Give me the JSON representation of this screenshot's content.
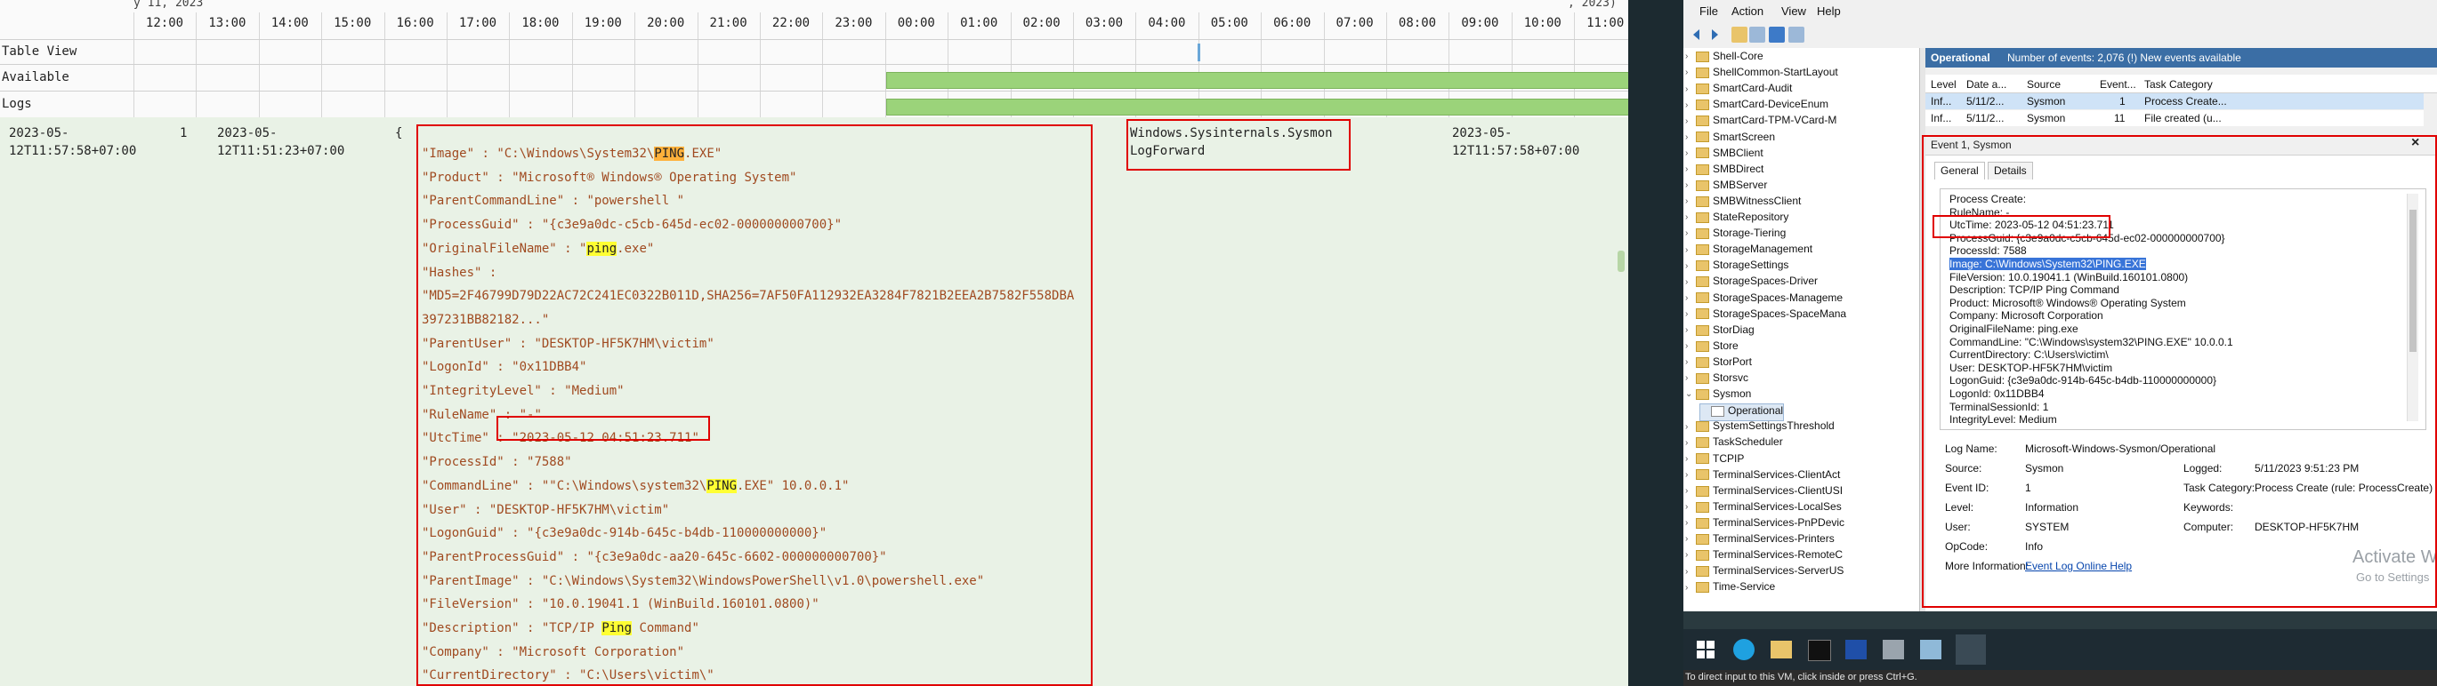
{
  "viewer": {
    "date_fragment": "y 11, 2023",
    "date_fragment_right": ", 2023)",
    "hours": [
      "12:00",
      "13:00",
      "14:00",
      "15:00",
      "16:00",
      "17:00",
      "18:00",
      "19:00",
      "20:00",
      "21:00",
      "22:00",
      "23:00",
      "00:00",
      "01:00",
      "02:00",
      "03:00",
      "04:00",
      "05:00",
      "06:00",
      "07:00",
      "08:00",
      "09:00",
      "10:00",
      "11:00"
    ],
    "row_labels": {
      "table_view": "Table View",
      "available": "Available",
      "logs": "Logs"
    },
    "row": {
      "col1": "2023-05-\n12T11:57:58+07:00",
      "col2": "1",
      "col3": "2023-05-\n12T11:51:23+07:00",
      "marker": "{",
      "source": "Windows.Sysinternals.Sysmon\nLogForward",
      "col_end": "2023-05-\n12T11:57:58+07:00"
    },
    "record": [
      {
        "k": "\"Image\"",
        "v_pre": "\"C:\\Windows\\System32\\",
        "hl": "PING",
        "hl_type": "orange",
        "v_post": ".EXE\""
      },
      {
        "k": "\"Product\"",
        "v_pre": "\"Microsoft® Windows® Operating System\"",
        "hl": "",
        "hl_type": "",
        "v_post": ""
      },
      {
        "k": "\"ParentCommandLine\"",
        "v_pre": "\"powershell \"",
        "hl": "",
        "hl_type": "",
        "v_post": ""
      },
      {
        "k": "\"ProcessGuid\"",
        "v_pre": "\"{c3e9a0dc-c5cb-645d-ec02-000000000700}\"",
        "hl": "",
        "hl_type": "",
        "v_post": ""
      },
      {
        "k": "\"OriginalFileName\"",
        "v_pre": "\"",
        "hl": "ping",
        "hl_type": "yellow",
        "v_post": ".exe\""
      },
      {
        "k": "\"Hashes\"",
        "v_pre": "",
        "hl": "",
        "hl_type": "",
        "v_post": ""
      },
      {
        "k": "",
        "v_pre": "\"MD5=2F46799D79D22AC72C241EC0322B011D,SHA256=7AF50FA112932EA3284F7821B2EEA2B7582F558DBA",
        "hl": "",
        "hl_type": "",
        "v_post": ""
      },
      {
        "k": "",
        "v_pre": "397231BB82182...\"",
        "hl": "",
        "hl_type": "",
        "v_post": ""
      },
      {
        "k": "\"ParentUser\"",
        "v_pre": "\"DESKTOP-HF5K7HM\\victim\"",
        "hl": "",
        "hl_type": "",
        "v_post": ""
      },
      {
        "k": "\"LogonId\"",
        "v_pre": "\"0x11DBB4\"",
        "hl": "",
        "hl_type": "",
        "v_post": ""
      },
      {
        "k": "\"IntegrityLevel\"",
        "v_pre": "\"Medium\"",
        "hl": "",
        "hl_type": "",
        "v_post": ""
      },
      {
        "k": "\"RuleName\"",
        "v_pre": "\"-\"",
        "hl": "",
        "hl_type": "",
        "v_post": ""
      },
      {
        "k": "\"UtcTime\"",
        "v_pre": "\"2023-05-12 04:51:23.711\"",
        "hl": "",
        "hl_type": "",
        "v_post": ""
      },
      {
        "k": "\"ProcessId\"",
        "v_pre": "\"7588\"",
        "hl": "",
        "hl_type": "",
        "v_post": ""
      },
      {
        "k": "\"CommandLine\"",
        "v_pre": "\"\"C:\\Windows\\system32\\",
        "hl": "PING",
        "hl_type": "yellow",
        "v_post": ".EXE\" 10.0.0.1\""
      },
      {
        "k": "\"User\"",
        "v_pre": "\"DESKTOP-HF5K7HM\\victim\"",
        "hl": "",
        "hl_type": "",
        "v_post": ""
      },
      {
        "k": "\"LogonGuid\"",
        "v_pre": "\"{c3e9a0dc-914b-645c-b4db-110000000000}\"",
        "hl": "",
        "hl_type": "",
        "v_post": ""
      },
      {
        "k": "\"ParentProcessGuid\"",
        "v_pre": "\"{c3e9a0dc-aa20-645c-6602-000000000700}\"",
        "hl": "",
        "hl_type": "",
        "v_post": ""
      },
      {
        "k": "\"ParentImage\"",
        "v_pre": "\"C:\\Windows\\System32\\WindowsPowerShell\\v1.0\\powershell.exe\"",
        "hl": "",
        "hl_type": "",
        "v_post": ""
      },
      {
        "k": "\"FileVersion\"",
        "v_pre": "\"10.0.19041.1 (WinBuild.160101.0800)\"",
        "hl": "",
        "hl_type": "",
        "v_post": ""
      },
      {
        "k": "\"Description\"",
        "v_pre": "\"TCP/IP ",
        "hl": "Ping",
        "hl_type": "yellow",
        "v_post": " Command\""
      },
      {
        "k": "\"Company\"",
        "v_pre": "\"Microsoft Corporation\"",
        "hl": "",
        "hl_type": "",
        "v_post": ""
      },
      {
        "k": "\"CurrentDirectory\"",
        "v_pre": "\"C:\\Users\\victim\\\"",
        "hl": "",
        "hl_type": "",
        "v_post": ""
      }
    ]
  },
  "eventviewer": {
    "menu": [
      "File",
      "Action",
      "View",
      "Help"
    ],
    "tree": [
      "Shell-Core",
      "ShellCommon-StartLayout",
      "SmartCard-Audit",
      "SmartCard-DeviceEnum",
      "SmartCard-TPM-VCard-M",
      "SmartScreen",
      "SMBClient",
      "SMBDirect",
      "SMBServer",
      "SMBWitnessClient",
      "StateRepository",
      "Storage-Tiering",
      "StorageManagement",
      "StorageSettings",
      "StorageSpaces-Driver",
      "StorageSpaces-Manageme",
      "StorageSpaces-SpaceMana",
      "StorDiag",
      "Store",
      "StorPort",
      "Storsvc",
      "Sysmon",
      "Operational",
      "SystemSettingsThreshold",
      "TaskScheduler",
      "TCPIP",
      "TerminalServices-ClientAct",
      "TerminalServices-ClientUSI",
      "TerminalServices-LocalSes",
      "TerminalServices-PnPDevic",
      "TerminalServices-Printers",
      "TerminalServices-RemoteC",
      "TerminalServices-ServerUS",
      "Time-Service"
    ],
    "log_title": "Operational",
    "log_subtitle": "Number of events: 2,076 (!) New events available",
    "list_headers": [
      "Level",
      "Date a...",
      "Source",
      "Event...",
      "Task Category"
    ],
    "list_rows": [
      [
        "Inf...",
        "5/11/2...",
        "Sysmon",
        "1",
        "Process Create..."
      ],
      [
        "Inf...",
        "5/11/2...",
        "Sysmon",
        "11",
        "File created (u..."
      ]
    ],
    "event_title": "Event 1, Sysmon",
    "close_glyph": "×",
    "tabs": [
      "General",
      "Details"
    ],
    "xml_lines": [
      "Process Create:",
      "RuleName: -",
      "UtcTime: 2023-05-12 04:51:23.711",
      "ProcessGuid: {c3e9a0dc-c5cb-645d-ec02-000000000700}",
      "ProcessId: 7588",
      "Image: C:\\Windows\\System32\\PING.EXE",
      "FileVersion: 10.0.19041.1 (WinBuild.160101.0800)",
      "Description: TCP/IP Ping Command",
      "Product: Microsoft® Windows® Operating System",
      "Company: Microsoft Corporation",
      "OriginalFileName: ping.exe",
      "CommandLine: \"C:\\Windows\\system32\\PING.EXE\" 10.0.0.1",
      "CurrentDirectory: C:\\Users\\victim\\",
      "User: DESKTOP-HF5K7HM\\victim",
      "LogonGuid: {c3e9a0dc-914b-645c-b4db-110000000000}",
      "LogonId: 0x11DBB4",
      "TerminalSessionId: 1",
      "IntegrityLevel: Medium"
    ],
    "props": {
      "log_name_label": "Log Name:",
      "log_name": "Microsoft-Windows-Sysmon/Operational",
      "source_label": "Source:",
      "source": "Sysmon",
      "logged_label": "Logged:",
      "logged": "5/11/2023 9:51:23 PM",
      "event_id_label": "Event ID:",
      "event_id": "1",
      "task_label": "Task Category:",
      "task": "Process Create (rule: ProcessCreate)",
      "level_label": "Level:",
      "level": "Information",
      "keywords_label": "Keywords:",
      "user_label": "User:",
      "user": "SYSTEM",
      "computer_label": "Computer:",
      "computer": "DESKTOP-HF5K7HM",
      "opcode_label": "OpCode:",
      "opcode": "Info",
      "more_label": "More Information:",
      "more_link": "Event Log Online Help"
    },
    "watermark_1": "Activate W",
    "watermark_2": "Go to Settings",
    "status": "To direct input to this VM, click inside or press Ctrl+G."
  },
  "colors": {
    "accent_red": "#e00000",
    "timeline_green": "#9bd37a",
    "highlight_yellow": "#ffff33",
    "highlight_orange": "#ffb13b"
  }
}
